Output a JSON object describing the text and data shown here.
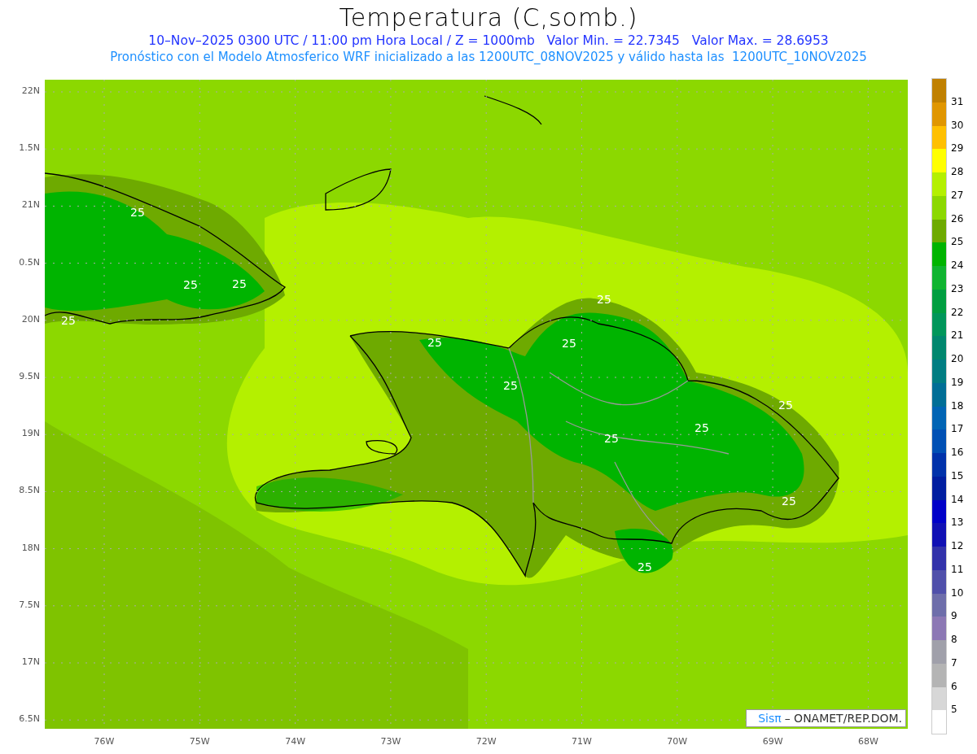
{
  "title": "Temperatura (C,somb.)",
  "subtitle": "10–Nov–2025 0300 UTC / 11:00 pm Hora Local / Z = 1000mb   Valor Min. = 22.7345   Valor Max. = 28.6953",
  "description": "Pronóstico con el Modelo Atmosferico WRF inicializado a las 1200UTC_08NOV2025 y válido hasta las  1200UTC_10NOV2025",
  "map": {
    "lat_labels": [
      "22N",
      "1.5N",
      "21N",
      "0.5N",
      "20N",
      "9.5N",
      "19N",
      "8.5N",
      "18N",
      "7.5N",
      "17N",
      "6.5N"
    ],
    "lon_labels": [
      "76W",
      "75W",
      "74W",
      "73W",
      "72W",
      "71W",
      "70W",
      "69W",
      "68W"
    ],
    "contour_labels": [
      "25",
      "25",
      "25",
      "25",
      "25",
      "25",
      "25",
      "25",
      "25",
      "25",
      "25",
      "25",
      "25"
    ],
    "credit": {
      "brand": "Sisπ",
      "text": "– ONAMET/REP.DOM."
    }
  },
  "colorbar": [
    {
      "color": "#c08000"
    },
    {
      "label": "31",
      "color": "#e09600"
    },
    {
      "label": "30",
      "color": "#ffc000"
    },
    {
      "label": "29",
      "color": "#ffff00"
    },
    {
      "label": "28",
      "color": "#b4f000"
    },
    {
      "label": "27",
      "color": "#8cd800"
    },
    {
      "label": "26",
      "color": "#6eaa00"
    },
    {
      "label": "25",
      "color": "#00b400"
    },
    {
      "label": "24",
      "color": "#10b430"
    },
    {
      "label": "23",
      "color": "#009e40"
    },
    {
      "label": "22",
      "color": "#00965a"
    },
    {
      "label": "21",
      "color": "#00876e"
    },
    {
      "label": "20",
      "color": "#007d82"
    },
    {
      "label": "19",
      "color": "#006e96"
    },
    {
      "label": "18",
      "color": "#0064b4"
    },
    {
      "label": "17",
      "color": "#0050b4"
    },
    {
      "label": "16",
      "color": "#0032aa"
    },
    {
      "label": "15",
      "color": "#001ea0"
    },
    {
      "label": "14",
      "color": "#0000c8"
    },
    {
      "label": "13",
      "color": "#1010b4"
    },
    {
      "label": "12",
      "color": "#3232aa"
    },
    {
      "label": "11",
      "color": "#5050aa"
    },
    {
      "label": "10",
      "color": "#6e6eaa"
    },
    {
      "label": "9",
      "color": "#8c78b4"
    },
    {
      "label": "8",
      "color": "#a0a0aa"
    },
    {
      "label": "7",
      "color": "#b4b4b4"
    },
    {
      "label": "6",
      "color": "#d7d7d7"
    },
    {
      "label": "5",
      "color": "#ffffff"
    }
  ]
}
